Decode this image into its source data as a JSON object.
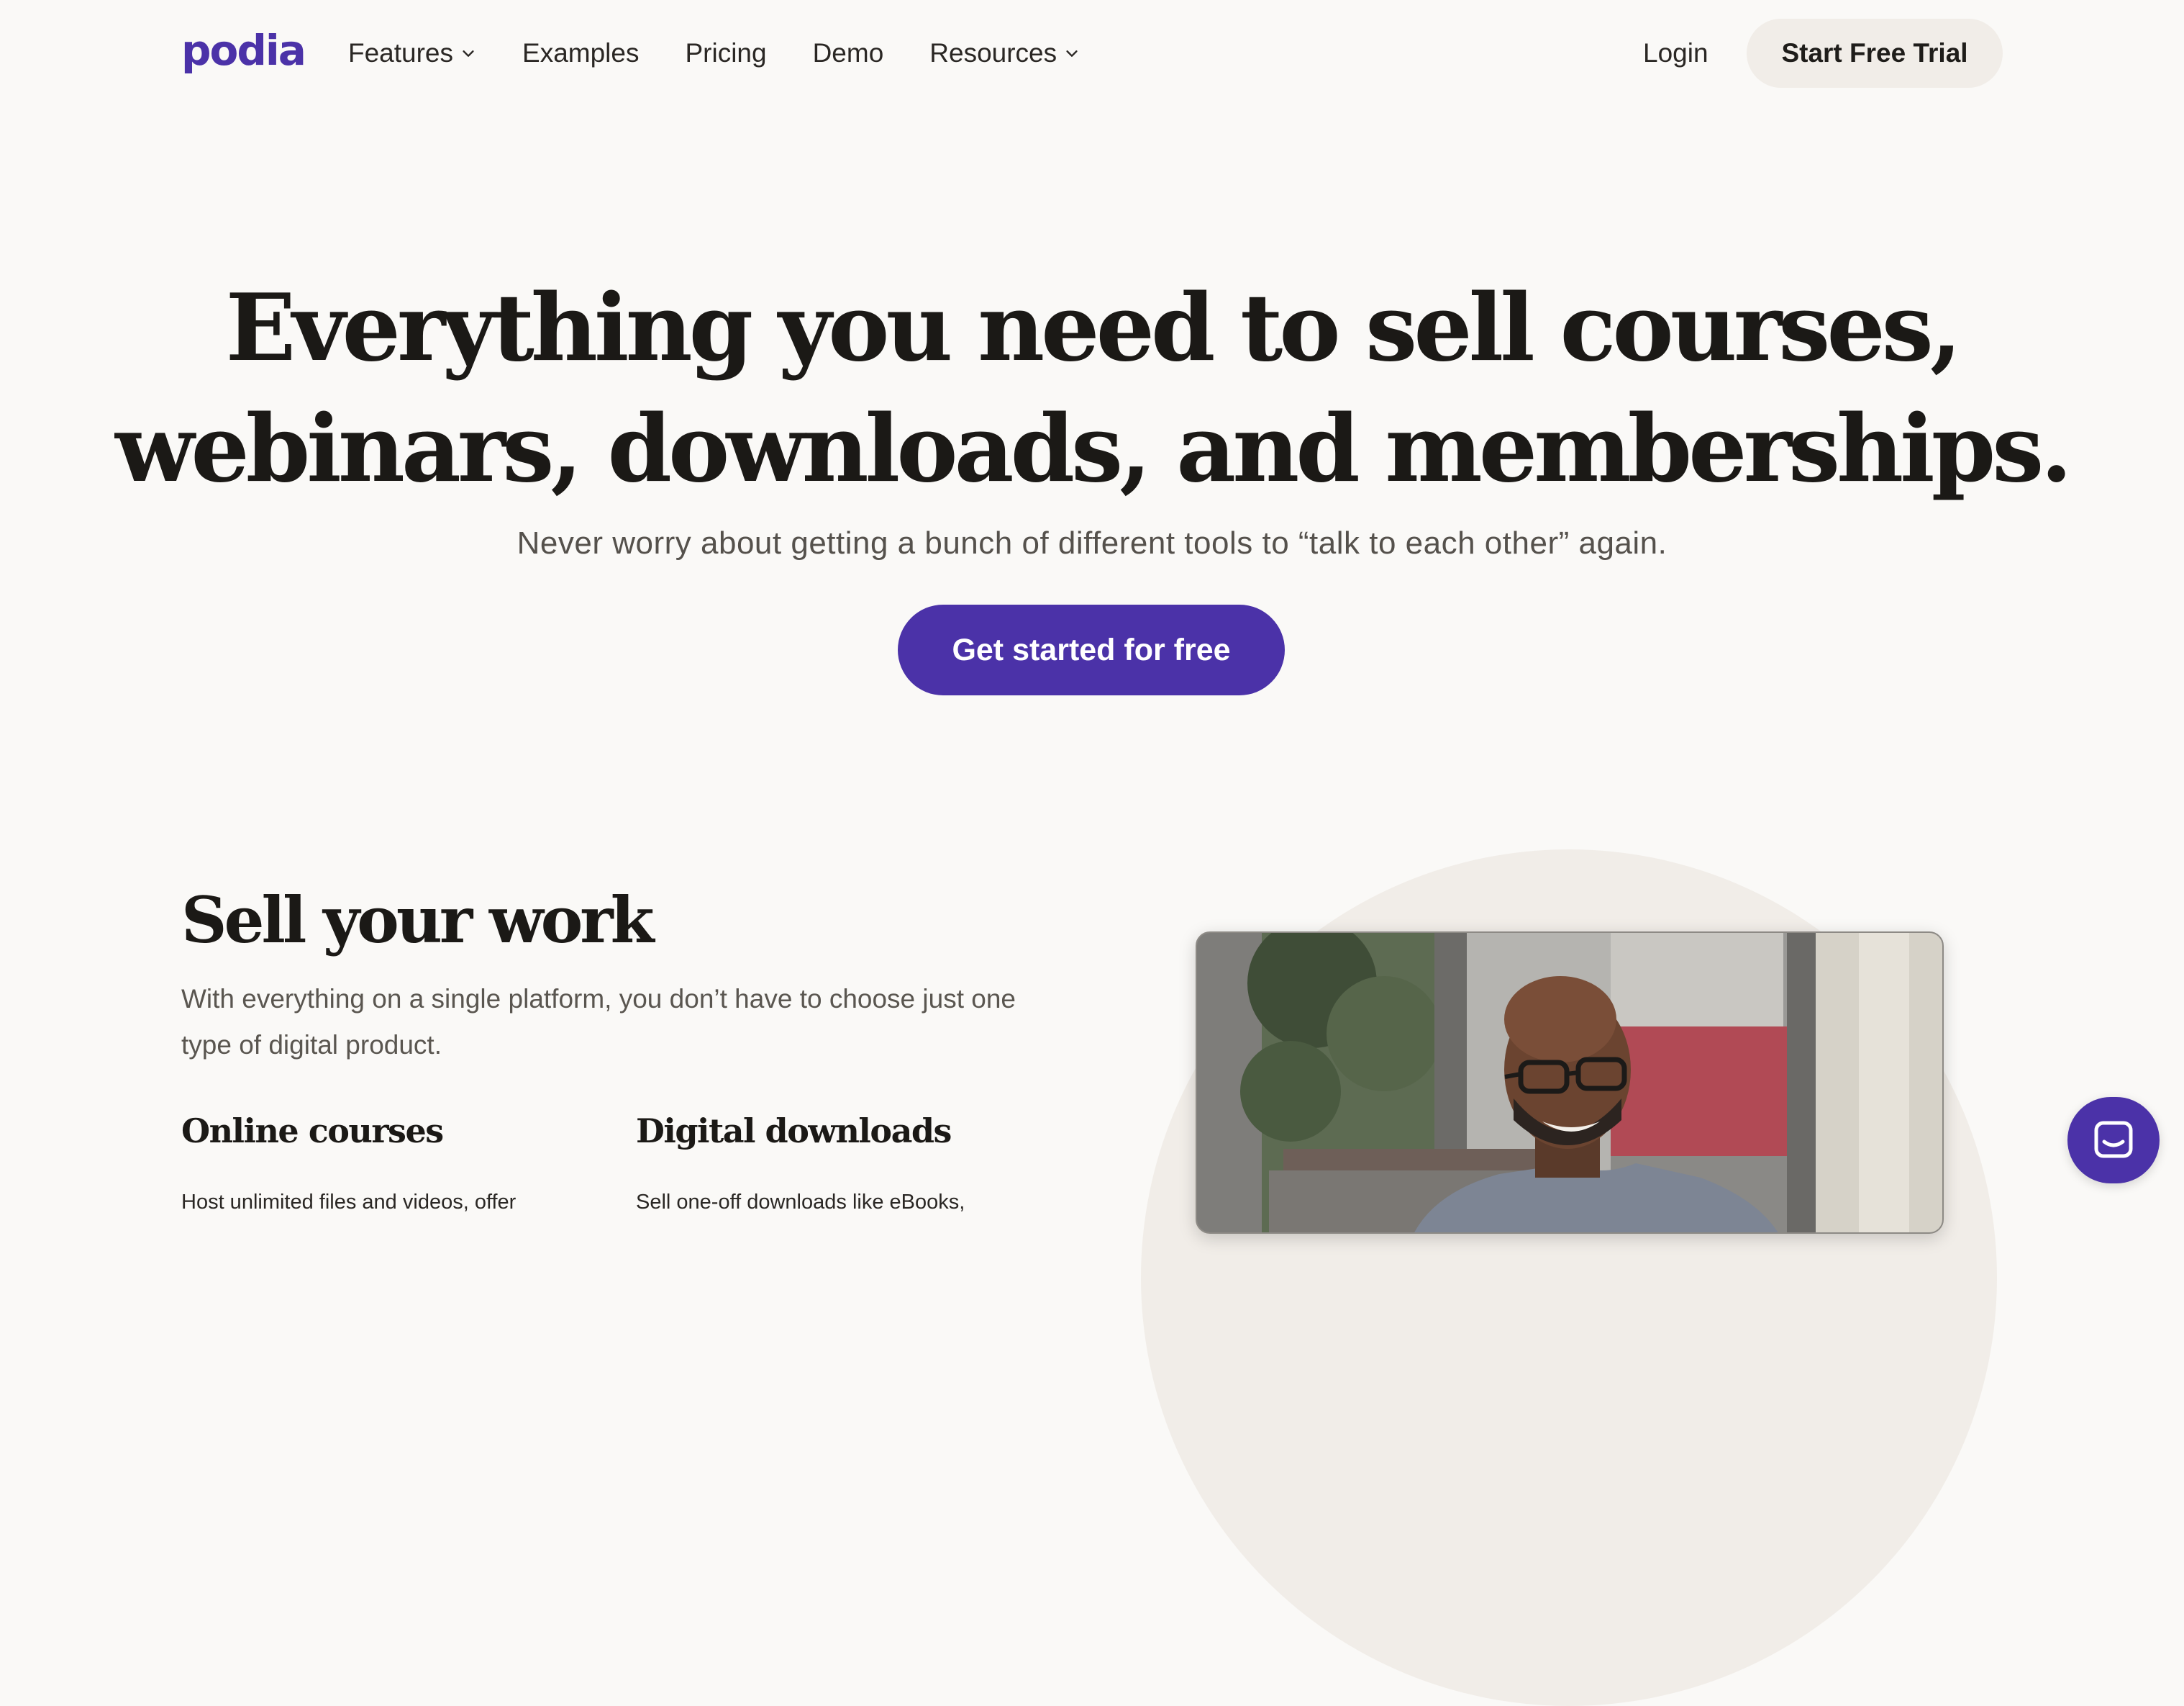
{
  "nav": {
    "logo": "podia",
    "links": [
      {
        "label": "Features",
        "dropdown": true
      },
      {
        "label": "Examples",
        "dropdown": false
      },
      {
        "label": "Pricing",
        "dropdown": false
      },
      {
        "label": "Demo",
        "dropdown": false
      },
      {
        "label": "Resources",
        "dropdown": true
      }
    ],
    "login": "Login",
    "trial_button": "Start Free Trial"
  },
  "hero": {
    "title_line1": "Everything you need to sell courses,",
    "title_line2": "webinars, downloads, and memberships.",
    "subtitle": "Never worry about getting a bunch of different tools to “talk to each other” again.",
    "cta": "Get started for free"
  },
  "section": {
    "title": "Sell your work",
    "description": "With everything on a single platform, you don’t have to choose just one type of digital product.",
    "features": [
      {
        "title": "Online courses",
        "text": "Host unlimited files and videos, offer"
      },
      {
        "title": "Digital downloads",
        "text": "Sell one-off downloads like eBooks,"
      }
    ]
  },
  "icons": {
    "chevron": "chevron-down-icon",
    "chat": "chat-icon"
  },
  "colors": {
    "brand": "#4b32a8",
    "background": "#faf9f7",
    "pill": "#f1ede8"
  }
}
